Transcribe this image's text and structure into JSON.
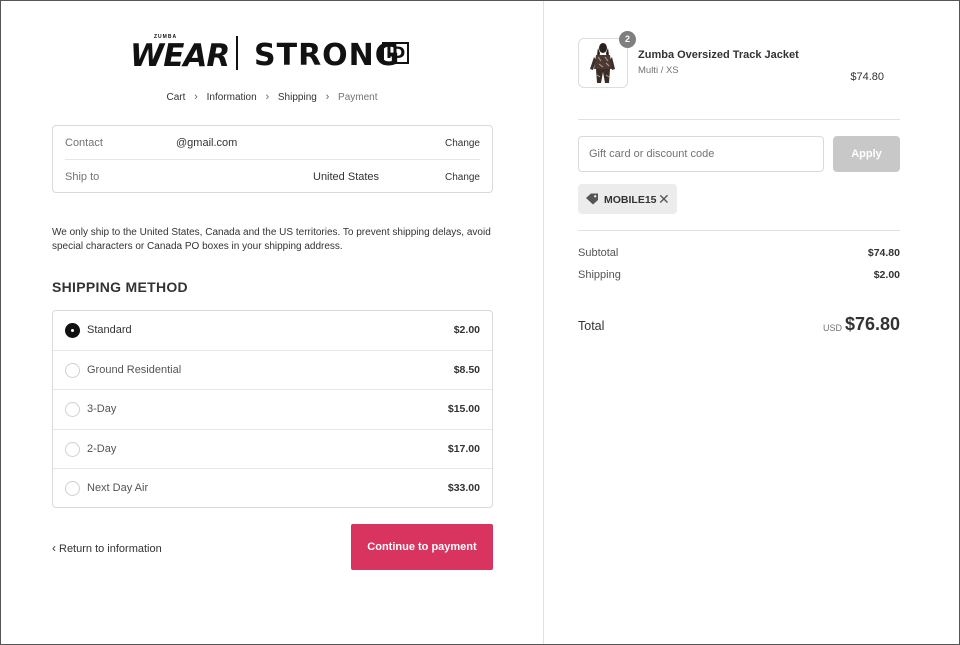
{
  "brand": {
    "zumba_small": "ZUMBA",
    "wear": "WEAR",
    "strong": "STRONG",
    "id": "ID"
  },
  "breadcrumb": {
    "items": [
      "Cart",
      "Information",
      "Shipping",
      "Payment"
    ]
  },
  "review": {
    "contact_label": "Contact",
    "contact_value": "@gmail.com",
    "ship_to_label": "Ship to",
    "ship_to_value": "United States",
    "change_label": "Change"
  },
  "notice": "We only ship to the United States, Canada and the US territories. To prevent shipping delays, avoid special characters or Canada PO boxes in your shipping address.",
  "shipping": {
    "title": "SHIPPING METHOD",
    "methods": [
      {
        "name": "Standard",
        "price": "$2.00",
        "selected": true
      },
      {
        "name": "Ground Residential",
        "price": "$8.50",
        "selected": false
      },
      {
        "name": "3-Day",
        "price": "$15.00",
        "selected": false
      },
      {
        "name": "2-Day",
        "price": "$17.00",
        "selected": false
      },
      {
        "name": "Next Day Air",
        "price": "$33.00",
        "selected": false
      }
    ]
  },
  "nav": {
    "return_label": "Return to information",
    "continue_label": "Continue to payment"
  },
  "colors": {
    "accent": "#d9345f",
    "apply_disabled": "#c8c8c8"
  },
  "cart": {
    "quantity": "2",
    "product_name": "Zumba Oversized Track Jacket",
    "product_variant": "Multi / XS",
    "product_price": "$74.80"
  },
  "discount": {
    "placeholder": "Gift card or discount code",
    "apply_label": "Apply",
    "applied_code": "MOBILE15"
  },
  "summary": {
    "subtotal_label": "Subtotal",
    "subtotal_value": "$74.80",
    "shipping_label": "Shipping",
    "shipping_value": "$2.00",
    "total_label": "Total",
    "currency": "USD",
    "total_value": "$76.80"
  },
  "icons": [
    "chevron-right-icon",
    "chevron-left-icon",
    "radio-icon",
    "tag-icon",
    "close-icon"
  ]
}
